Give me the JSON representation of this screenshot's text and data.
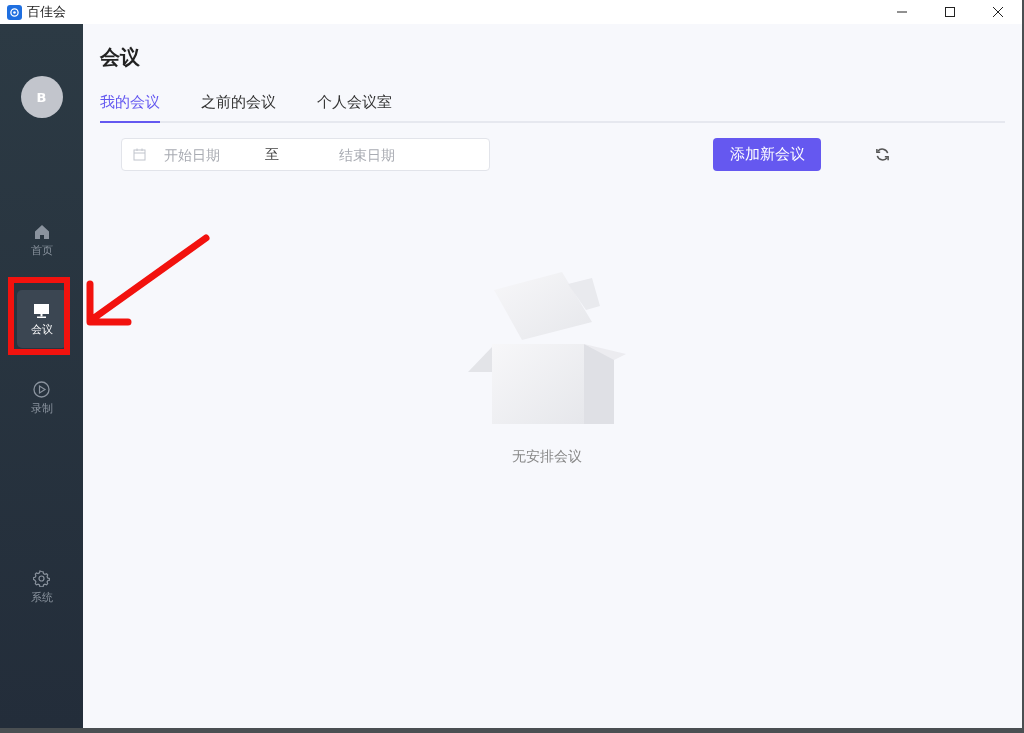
{
  "window": {
    "title": "百佳会"
  },
  "sidebar": {
    "avatar": "B",
    "items": [
      {
        "label": "首页",
        "kind": "home",
        "selected": false
      },
      {
        "label": "会议",
        "kind": "monitor",
        "selected": true
      },
      {
        "label": "录制",
        "kind": "play",
        "selected": false
      },
      {
        "label": "系统",
        "kind": "gear",
        "selected": false
      }
    ]
  },
  "page": {
    "title": "会议",
    "tabs": [
      {
        "label": "我的会议",
        "selected": true
      },
      {
        "label": "之前的会议",
        "selected": false
      },
      {
        "label": "个人会议室",
        "selected": false
      }
    ],
    "date_range": {
      "start_placeholder": "开始日期",
      "separator": "至",
      "end_placeholder": "结束日期"
    },
    "add_button": "添加新会议",
    "empty_text": "无安排会议"
  },
  "annotations": {
    "highlight_frame": true,
    "arrow": true
  }
}
